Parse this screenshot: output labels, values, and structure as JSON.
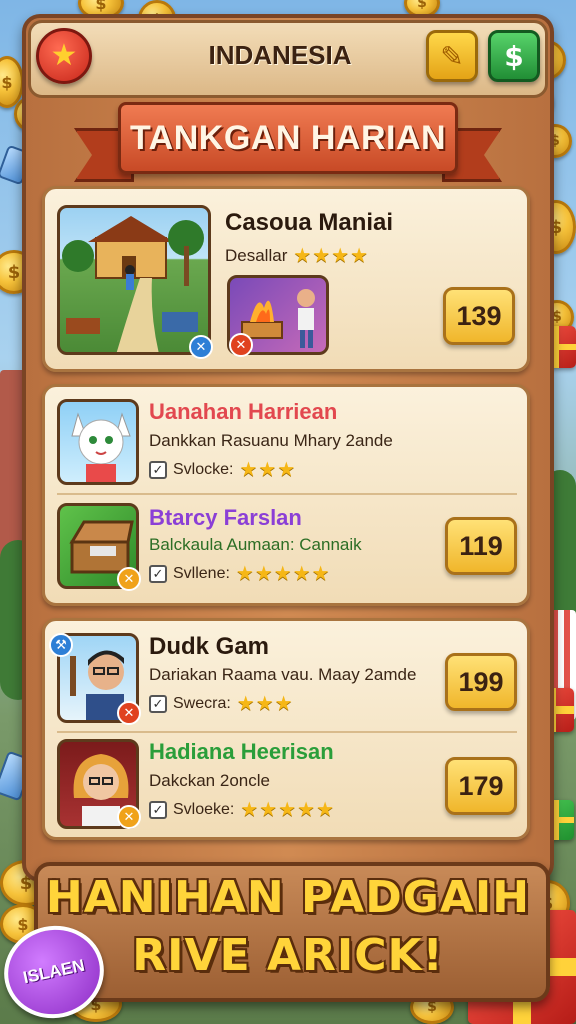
{
  "header": {
    "title": "INDANESIA",
    "star_icon": "star-icon",
    "edit_icon": "pencil-icon",
    "cash_icon": "dollar-icon",
    "dollar_symbol": "$"
  },
  "banner": {
    "title": "TANKGAN HARIAN"
  },
  "cards": [
    {
      "name": "Casoua Maniai",
      "subtitle": "Desallar",
      "stars": "★★★★",
      "price": "139",
      "name_color": "#2b1a0e"
    }
  ],
  "group2": [
    {
      "name": "Uanahan Harriean",
      "description": "Dankkan Rasuanu Mhary 2ande",
      "rating_label": "Svlocke:",
      "stars": "★★★",
      "name_color": "#e2484f"
    },
    {
      "name": "Btarcy Farslan",
      "description": "Balckaula Aumaan: Cannaik",
      "rating_label": "Svllene:",
      "stars": "★★★★★",
      "price": "119",
      "name_color": "#8b3fd6"
    }
  ],
  "group3": [
    {
      "name": "Dudk Gam",
      "description": "Dariakan Raama vau. Maay 2amde",
      "rating_label": "Swecra:",
      "stars": "★★★",
      "price": "199",
      "name_color": "#2b1a0e"
    },
    {
      "name": "Hadiana Heerisan",
      "description": "Dakckan 2oncle",
      "rating_label": "Svloeke:",
      "stars": "★★★★★",
      "price": "179",
      "name_color": "#2a9e3a"
    }
  ],
  "footer": {
    "line1": "HANIHAN PADGAIH",
    "line2": "RIVE ARICK!",
    "badge_label": "ISLAEN"
  },
  "colors": {
    "board_wood": "#c27a45",
    "banner_red": "#d9562f",
    "price_gold": "#f0b62b",
    "footer_text": "#ffd43a"
  }
}
